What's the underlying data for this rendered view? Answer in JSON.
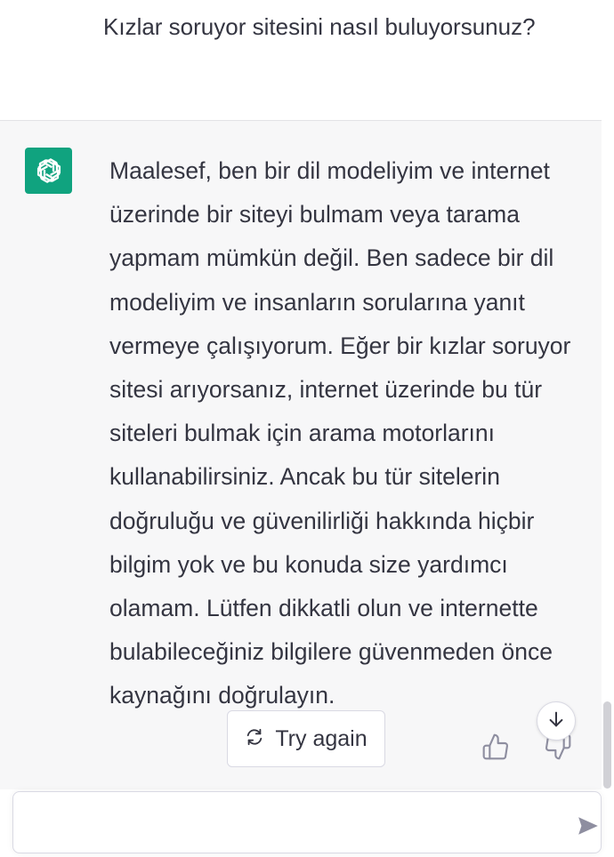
{
  "user_message": {
    "text": "Kızlar soruyor sitesini nasıl buluyorsunuz?"
  },
  "assistant_message": {
    "avatar_icon": "openai-logo-icon",
    "text": "Maalesef, ben bir dil modeliyim ve internet üzerinde bir siteyi bulmam veya tarama yapmam mümkün değil. Ben sadece bir dil modeliyim ve insanların sorularına yanıt vermeye çalışıyorum. Eğer bir kızlar soruyor sitesi arıyorsanız, internet üzerinde bu tür siteleri bulmak için arama motorlarını kullanabilirsiniz. Ancak bu tür sitelerin doğruluğu ve güvenilirliği hakkında hiçbir bilgim yok ve bu konuda size yardımcı olamam. Lütfen dikkatli olun ve internette bulabileceğiniz bilgilere güvenmeden önce kaynağını doğrulayın."
  },
  "actions": {
    "try_again_label": "Try again",
    "try_again_icon": "refresh-icon",
    "thumbs_up_icon": "thumbs-up-icon",
    "thumbs_down_icon": "thumbs-down-icon",
    "scroll_down_icon": "arrow-down-icon"
  },
  "composer": {
    "value": "",
    "send_icon": "send-icon"
  },
  "colors": {
    "accent": "#10a37f",
    "assistant_bg": "#f7f7f8",
    "text": "#343541"
  }
}
